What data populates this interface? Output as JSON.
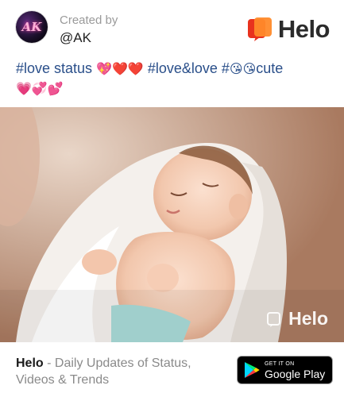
{
  "header": {
    "avatar_text": "AK",
    "created_by_label": "Created by",
    "handle": "@AK",
    "brand_name": "Helo"
  },
  "caption": {
    "part1": "#love status ",
    "emoji1": "💖❤️❤️",
    "part2": "  #love&love #",
    "emoji2": "😘😘",
    "part3": "cute",
    "emoji3": "💗💞💕"
  },
  "photo": {
    "description_icon": "baby-photo",
    "watermark_text": "Helo"
  },
  "footer": {
    "brand": "Helo",
    "tagline": " - Daily Updates of Status, Videos & Trends",
    "store_badge_small": "GET IT ON",
    "store_badge_big": "Google Play"
  },
  "colors": {
    "brand_orange": "#ff6a2a",
    "brand_red": "#e8321e",
    "caption_blue": "#2a4f8a"
  }
}
